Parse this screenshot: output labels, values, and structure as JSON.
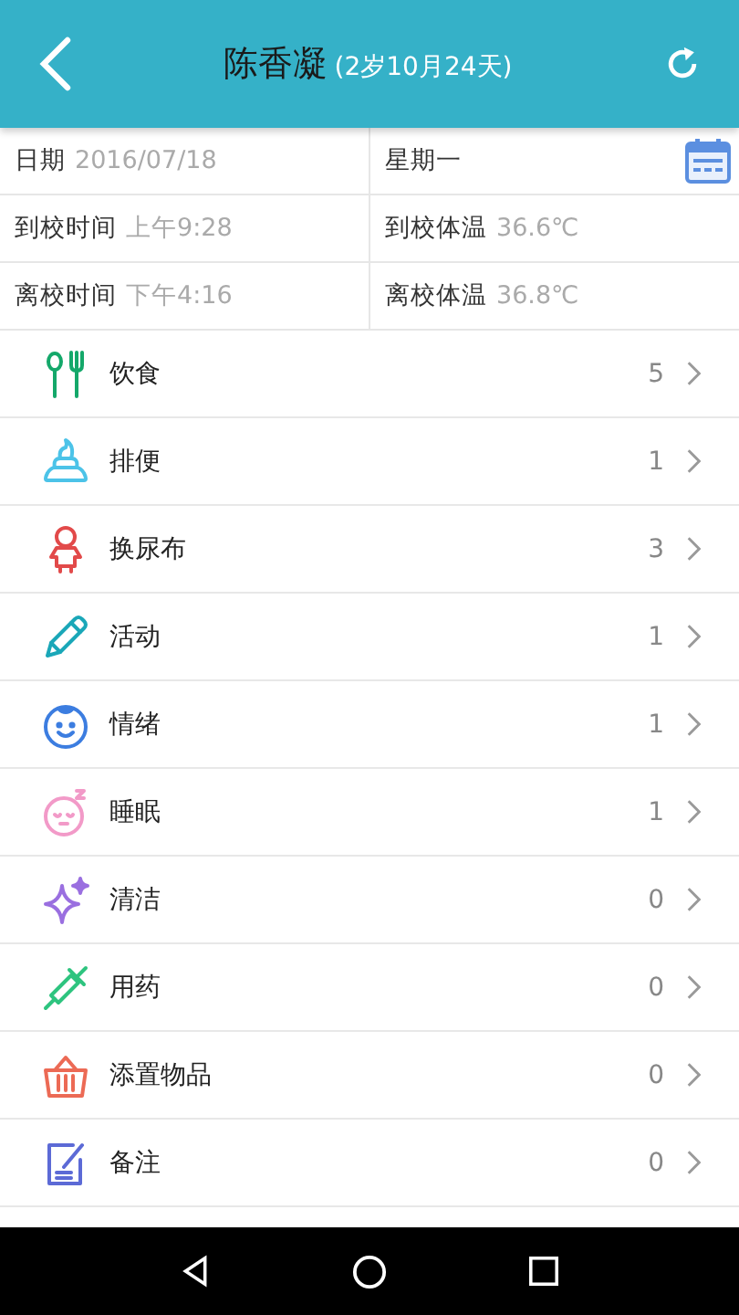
{
  "header": {
    "name": "陈香凝",
    "age": "(2岁10月24天)"
  },
  "info": [
    [
      {
        "kind": "field",
        "label": "日期",
        "value": "2016/07/18"
      },
      {
        "kind": "weekday",
        "label": "星期一"
      }
    ],
    [
      {
        "kind": "field",
        "label": "到校时间",
        "value": "上午9:28"
      },
      {
        "kind": "field",
        "label": "到校体温",
        "value": "36.6℃"
      }
    ],
    [
      {
        "kind": "field",
        "label": "离校时间",
        "value": "下午4:16"
      },
      {
        "kind": "field",
        "label": "离校体温",
        "value": "36.8℃"
      }
    ]
  ],
  "items": [
    {
      "kind": "food",
      "label": "饮食",
      "count": "5"
    },
    {
      "kind": "poop",
      "label": "排便",
      "count": "1"
    },
    {
      "kind": "diaper",
      "label": "换尿布",
      "count": "3"
    },
    {
      "kind": "activity",
      "label": "活动",
      "count": "1"
    },
    {
      "kind": "mood",
      "label": "情绪",
      "count": "1"
    },
    {
      "kind": "sleep",
      "label": "睡眠",
      "count": "1"
    },
    {
      "kind": "clean",
      "label": "清洁",
      "count": "0"
    },
    {
      "kind": "medicine",
      "label": "用药",
      "count": "0"
    },
    {
      "kind": "supplies",
      "label": "添置物品",
      "count": "0"
    },
    {
      "kind": "note",
      "label": "备注",
      "count": "0"
    }
  ]
}
